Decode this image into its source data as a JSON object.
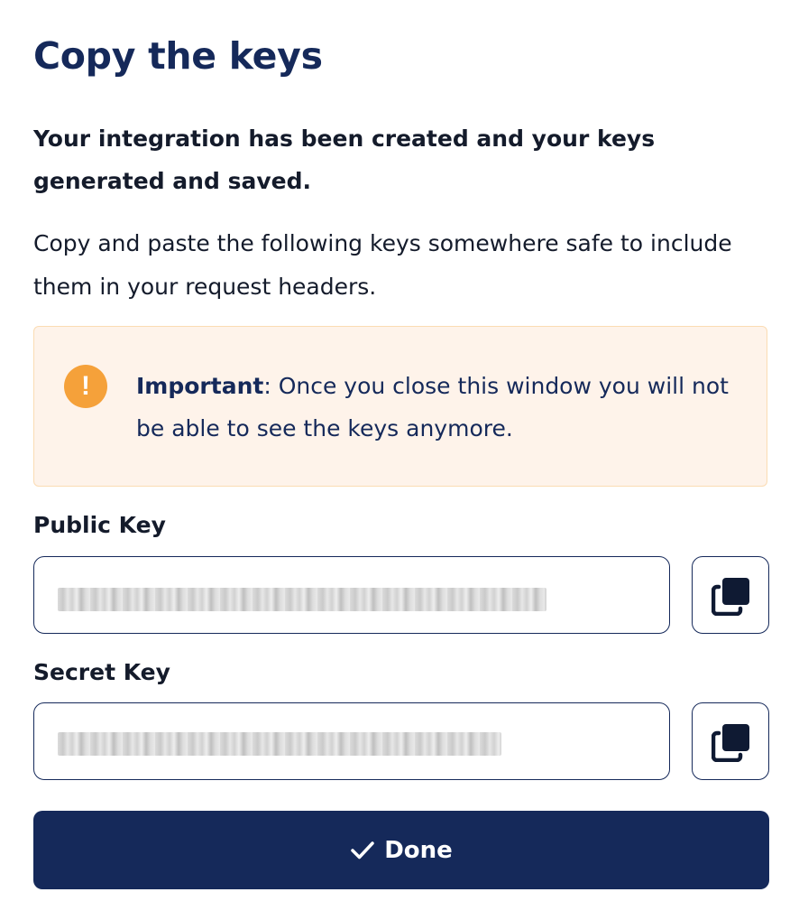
{
  "dialog": {
    "title": "Copy the keys",
    "intro_bold": "Your integration has been created and your keys generated and saved.",
    "intro": "Copy and paste the following keys somewhere safe to include them in your request headers."
  },
  "alert": {
    "icon": "exclamation-circle-icon",
    "icon_glyph": "!",
    "strong": "Important",
    "message": ": Once you close this window you will not be able to see the keys anymore.",
    "background_color": "#fef3ea",
    "icon_color": "#f5a13a"
  },
  "public_key": {
    "label": "Public Key",
    "value": "",
    "copy_icon": "copy-icon"
  },
  "secret_key": {
    "label": "Secret Key",
    "value": "",
    "copy_icon": "copy-icon"
  },
  "done_button": {
    "label": "Done",
    "icon": "checkmark-icon",
    "color": "#15295a"
  }
}
